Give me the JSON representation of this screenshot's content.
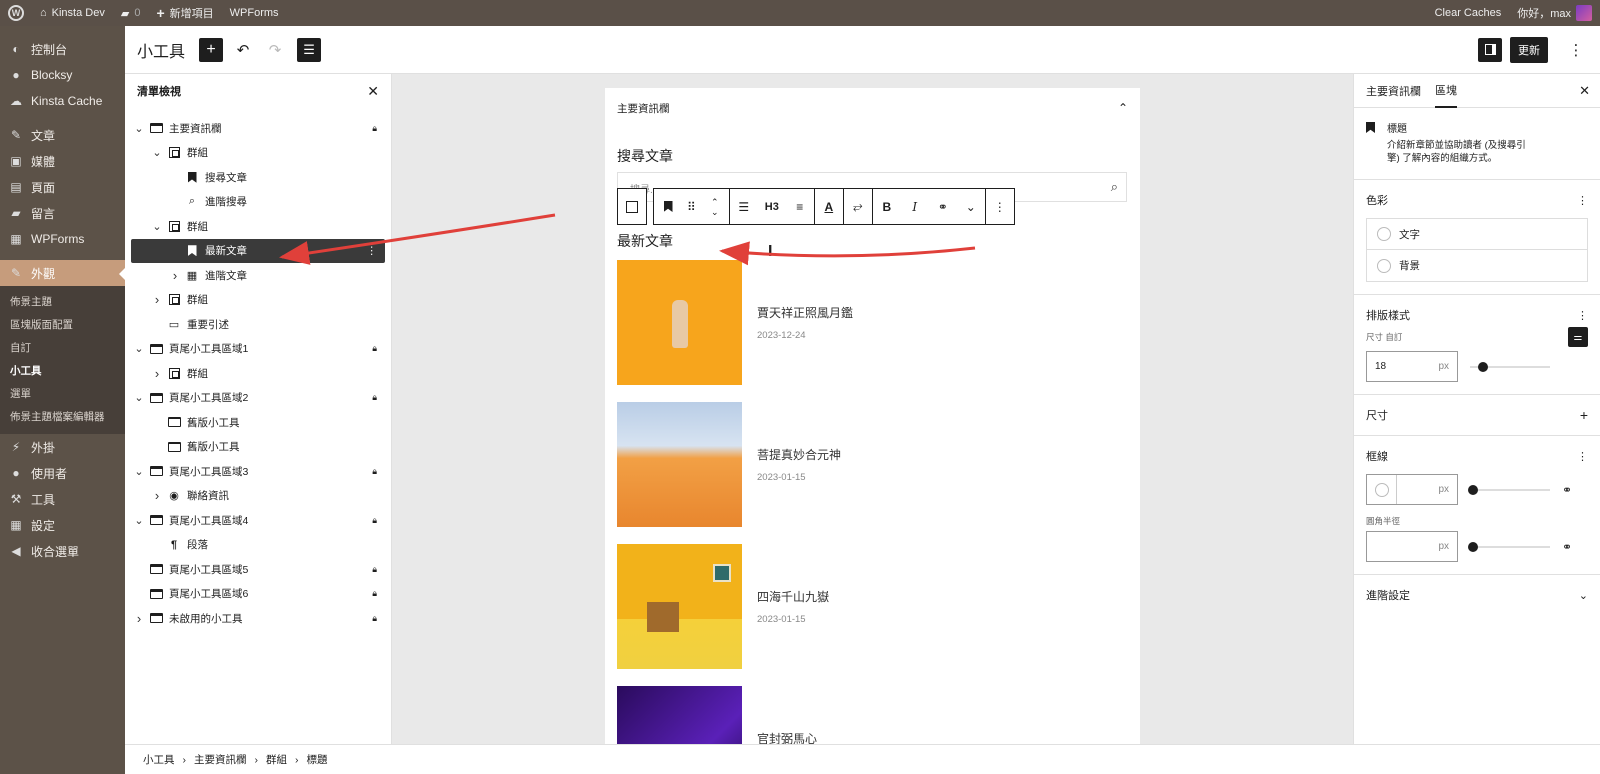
{
  "adminbar": {
    "site_name": "Kinsta Dev",
    "comments_count": "0",
    "new_label": "新增項目",
    "wpforms": "WPForms",
    "clear_caches": "Clear Caches",
    "greeting": "你好，max"
  },
  "admin_menu": {
    "items": [
      {
        "label": "控制台",
        "icon": "dashboard-icon"
      },
      {
        "label": "Blocksy",
        "icon": "blocksy-icon"
      },
      {
        "label": "Kinsta Cache",
        "icon": "cloud-icon"
      },
      {
        "label": "文章",
        "icon": "pin-icon"
      },
      {
        "label": "媒體",
        "icon": "media-icon"
      },
      {
        "label": "頁面",
        "icon": "page-icon"
      },
      {
        "label": "留言",
        "icon": "comment-icon"
      },
      {
        "label": "WPForms",
        "icon": "forms-icon"
      }
    ],
    "current": {
      "label": "外觀",
      "icon": "brush-icon"
    },
    "submenu": [
      "佈景主題",
      "區塊版面配置",
      "自訂",
      "小工具",
      "選單",
      "佈景主題檔案編輯器"
    ],
    "submenu_active": "小工具",
    "lower_items": [
      {
        "label": "外掛",
        "icon": "plugin-icon"
      },
      {
        "label": "使用者",
        "icon": "user-icon"
      },
      {
        "label": "工具",
        "icon": "wrench-icon"
      },
      {
        "label": "設定",
        "icon": "settings-icon"
      },
      {
        "label": "收合選單",
        "icon": "collapse-icon"
      }
    ]
  },
  "header": {
    "title": "小工具",
    "update_label": "更新"
  },
  "listview": {
    "title": "清單檢視",
    "rows": [
      {
        "label": "主要資訊欄",
        "icon": "widget-area-icon",
        "indent": 0,
        "chev": "v",
        "lock": true
      },
      {
        "label": "群組",
        "icon": "group-icon",
        "indent": 1,
        "chev": "v",
        "lock": false
      },
      {
        "label": "搜尋文章",
        "icon": "heading-bookmark-icon",
        "indent": 2,
        "chev": "",
        "lock": false
      },
      {
        "label": "進階搜尋",
        "icon": "search-icon",
        "indent": 2,
        "chev": "",
        "lock": false
      },
      {
        "label": "群組",
        "icon": "group-icon",
        "indent": 1,
        "chev": "v",
        "lock": false
      },
      {
        "label": "最新文章",
        "icon": "heading-bookmark-icon",
        "indent": 2,
        "chev": "",
        "lock": false,
        "selected": true
      },
      {
        "label": "進階文章",
        "icon": "grid-icon",
        "indent": 2,
        "chev": ">",
        "lock": false
      },
      {
        "label": "群組",
        "icon": "group-icon",
        "indent": 1,
        "chev": ">",
        "lock": false
      },
      {
        "label": "重要引述",
        "icon": "quote-icon",
        "indent": 1,
        "chev": "",
        "lock": false
      },
      {
        "label": "頁尾小工具區域1",
        "icon": "widget-area-icon",
        "indent": 0,
        "chev": "v",
        "lock": true
      },
      {
        "label": "群組",
        "icon": "group-icon",
        "indent": 1,
        "chev": ">",
        "lock": false
      },
      {
        "label": "頁尾小工具區域2",
        "icon": "widget-area-icon",
        "indent": 0,
        "chev": "v",
        "lock": true
      },
      {
        "label": "舊版小工具",
        "icon": "calendar-icon",
        "indent": 1,
        "chev": "",
        "lock": false
      },
      {
        "label": "舊版小工具",
        "icon": "calendar-icon",
        "indent": 1,
        "chev": "",
        "lock": false
      },
      {
        "label": "頁尾小工具區域3",
        "icon": "widget-area-icon",
        "indent": 0,
        "chev": "v",
        "lock": true
      },
      {
        "label": "聯絡資訊",
        "icon": "contact-icon",
        "indent": 1,
        "chev": ">",
        "lock": false
      },
      {
        "label": "頁尾小工具區域4",
        "icon": "widget-area-icon",
        "indent": 0,
        "chev": "v",
        "lock": true
      },
      {
        "label": "段落",
        "icon": "paragraph-icon",
        "indent": 1,
        "chev": "",
        "lock": false
      },
      {
        "label": "頁尾小工具區域5",
        "icon": "widget-area-icon",
        "indent": 0,
        "chev": "",
        "lock": true
      },
      {
        "label": "頁尾小工具區域6",
        "icon": "widget-area-icon",
        "indent": 0,
        "chev": "",
        "lock": true
      },
      {
        "label": "未啟用的小工具",
        "icon": "widget-area-icon",
        "indent": 0,
        "chev": ">",
        "lock": true
      }
    ]
  },
  "canvas": {
    "area_title": "主要資訊欄",
    "search_heading": "搜尋文章",
    "search_placeholder": "搜尋...",
    "latest_heading": "最新文章",
    "toolbar_heading_level": "H3",
    "posts": [
      {
        "title": "賈天祥正照風月鑑",
        "date": "2023-12-24",
        "thumb": "hand-on-orange"
      },
      {
        "title": "菩提真妙合元神",
        "date": "2023-01-15",
        "thumb": "orange-umbrellas"
      },
      {
        "title": "四海千山九嶽",
        "date": "2023-01-15",
        "thumb": "yellow-building"
      },
      {
        "title": "官封弼馬心",
        "date": "",
        "thumb": "purple-abstract"
      }
    ]
  },
  "sidebar": {
    "tab1": "主要資訊欄",
    "tab2": "區塊",
    "block_name": "標題",
    "block_desc": "介紹新章節並協助讀者 (及搜尋引擎) 了解內容的組織方式。",
    "color_title": "色彩",
    "color_text": "文字",
    "color_bg": "背景",
    "typo_title": "排版樣式",
    "size_label": "尺寸 自訂",
    "size_value": "18",
    "size_unit": "px",
    "dimensions_title": "尺寸",
    "border_title": "框線",
    "border_unit": "px",
    "radius_label": "圓角半徑",
    "radius_unit": "px",
    "advanced_title": "進階設定"
  },
  "breadcrumb": [
    "小工具",
    "主要資訊欄",
    "群組",
    "標題"
  ],
  "colors": {
    "admin_menu_bg": "#5c5248",
    "accent": "#c69c7c",
    "arrow": "#e0403a"
  }
}
